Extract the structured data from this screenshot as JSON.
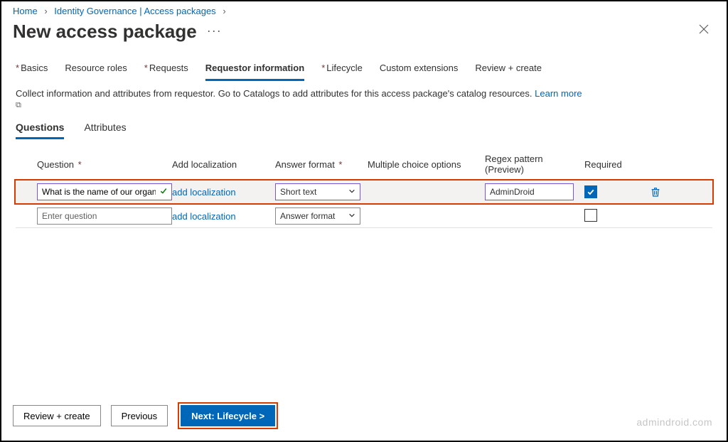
{
  "breadcrumb": {
    "items": [
      "Home",
      "Identity Governance | Access packages"
    ]
  },
  "page": {
    "title": "New access package",
    "more": "···"
  },
  "tabs": [
    {
      "label": "Basics",
      "required": true,
      "active": false
    },
    {
      "label": "Resource roles",
      "required": false,
      "active": false
    },
    {
      "label": "Requests",
      "required": true,
      "active": false
    },
    {
      "label": "Requestor information",
      "required": false,
      "active": true
    },
    {
      "label": "Lifecycle",
      "required": true,
      "active": false
    },
    {
      "label": "Custom extensions",
      "required": false,
      "active": false
    },
    {
      "label": "Review + create",
      "required": false,
      "active": false
    }
  ],
  "description": {
    "text": "Collect information and attributes from requestor. Go to Catalogs to add attributes for this access package's catalog resources.",
    "link": "Learn more"
  },
  "subtabs": {
    "questions": "Questions",
    "attributes": "Attributes"
  },
  "headers": {
    "question": "Question",
    "addloc": "Add localization",
    "answerformat": "Answer format",
    "multichoice": "Multiple choice options",
    "regex": "Regex pattern (Preview)",
    "required": "Required"
  },
  "rows": [
    {
      "question": "What is the name of our organ…",
      "addloc": "add localization",
      "format": "Short text",
      "regex": "AdminDroid",
      "required": true
    },
    {
      "question": "",
      "placeholder": "Enter question",
      "addloc": "add localization",
      "format": "Answer format",
      "regex": "",
      "required": false
    }
  ],
  "footer": {
    "review": "Review + create",
    "previous": "Previous",
    "next": "Next: Lifecycle >"
  },
  "watermark": "admindroid.com"
}
